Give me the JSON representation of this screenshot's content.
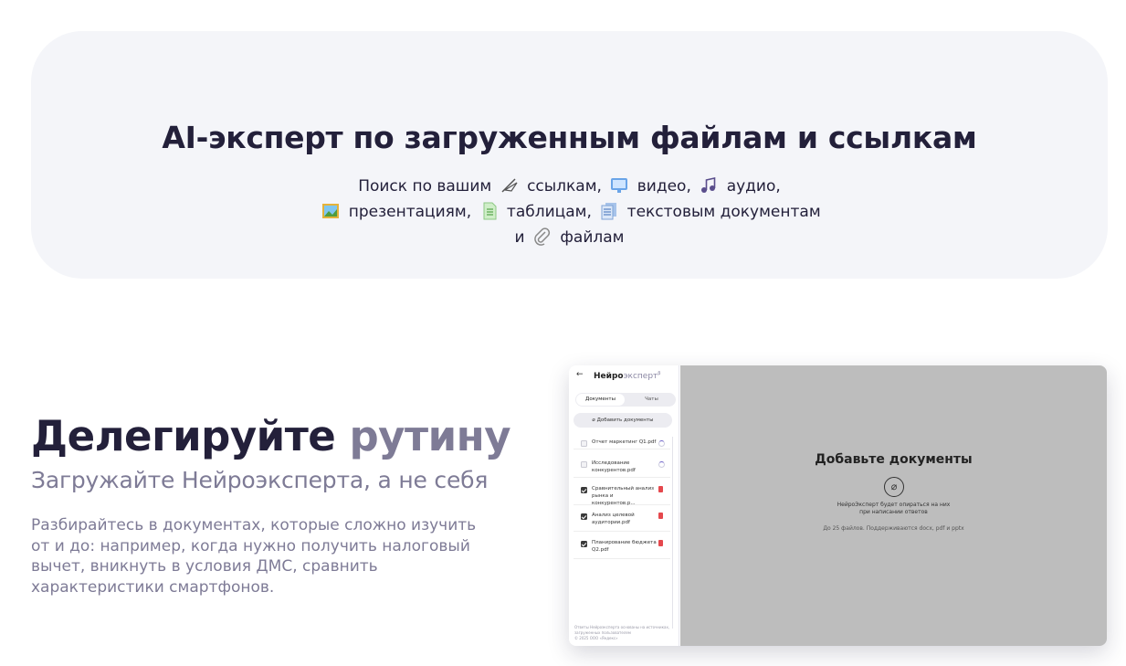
{
  "hero": {
    "title": "AI-эксперт по загруженным файлам и ссылкам",
    "line1": {
      "a": "Поиск по вашим",
      "b": "ссылкам,",
      "c": "видео,",
      "d": "аудио,"
    },
    "line2": {
      "a": "презентациям,",
      "b": "таблицам,",
      "c": "текстовым документам"
    },
    "line3": {
      "a": "и",
      "b": "файлам"
    }
  },
  "left": {
    "headline_1": "Делегируйте",
    "headline_2": "рутину",
    "subtitle": "Загружайте Нейроэксперта, а не себя",
    "description": "Разбирайтесь в документах, которые сложно изучить от и до: например, когда нужно получить налоговый вычет, вникнуть в условия ДМС, сравнить характеристики смартфонов."
  },
  "mockup": {
    "back": "←",
    "brand_a": "Нейро",
    "brand_b": "эксперт",
    "brand_sup": "β",
    "tab_docs": "Документы",
    "tab_chats": "Чаты",
    "add_button": "Добавить документы",
    "documents": [
      {
        "name": "Отчет маркетинг Q1.pdf",
        "checked": false,
        "state": "loading"
      },
      {
        "name": "Исследование конкурентов.pdf",
        "checked": false,
        "state": "loading"
      },
      {
        "name": "Сравнительный анализ рынка и конкурентов.p...",
        "checked": true,
        "state": "pdf"
      },
      {
        "name": "Анализ целевой аудитории.pdf",
        "checked": true,
        "state": "pdf"
      },
      {
        "name": "Планирование бюджета Q2.pdf",
        "checked": true,
        "state": "pdf"
      }
    ],
    "footer_1": "Ответы Нейроэксперта основаны на источниках, загруженных пользователем",
    "footer_2": "© 2025 ООО «Яндекс»",
    "main_title": "Добавьте документы",
    "main_hint_1": "НейроЭксперт будет опираться на них",
    "main_hint_2": "при написании ответов",
    "main_limit": "До 25 файлов. Поддерживаются docx, pdf и pptx"
  },
  "colors": {
    "accent_muted": "#7e7b96",
    "dark_text": "#23203a",
    "hero_bg": "#f4f5f9",
    "mock_main_bg": "#bdbdbd"
  }
}
